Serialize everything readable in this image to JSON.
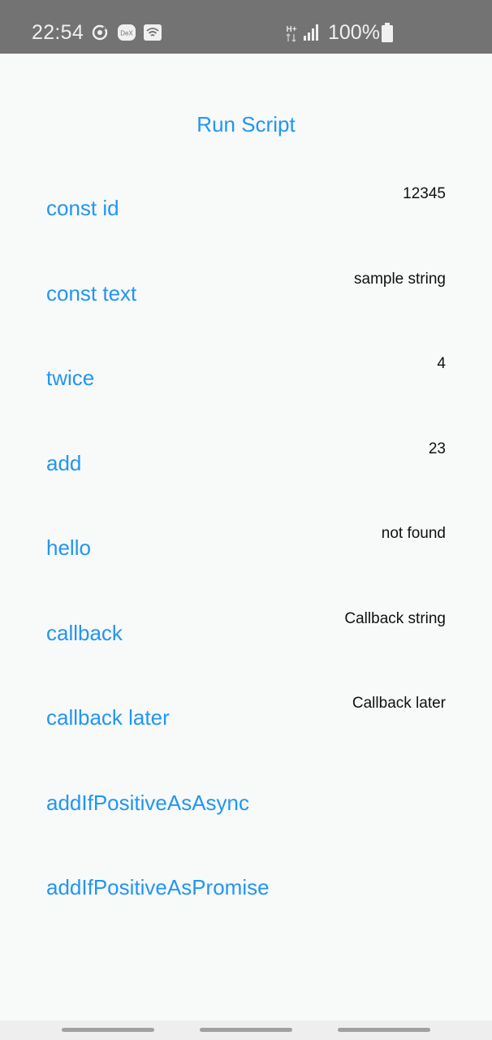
{
  "status_bar": {
    "time": "22:54",
    "icons": [
      "sync-icon",
      "dex-icon",
      "wifi-icon",
      "data-arrows-icon",
      "signal-icon",
      "battery-icon"
    ],
    "dex_label": "DeX",
    "network_label": "H+",
    "battery_text": "100%"
  },
  "app": {
    "run_script_label": "Run Script",
    "rows": [
      {
        "label": "const id",
        "value": "12345"
      },
      {
        "label": "const text",
        "value": "sample string"
      },
      {
        "label": "twice",
        "value": "4"
      },
      {
        "label": "add",
        "value": "23"
      },
      {
        "label": "hello",
        "value": "not found"
      },
      {
        "label": "callback",
        "value": "Callback string"
      },
      {
        "label": "callback later",
        "value": "Callback later"
      },
      {
        "label": "addIfPositiveAsAsync",
        "value": ""
      },
      {
        "label": "addIfPositiveAsPromise",
        "value": ""
      }
    ]
  },
  "colors": {
    "accent": "#2196f3",
    "status_bar_bg": "#737373",
    "background": "#f8f9f9",
    "value_text": "#111111"
  }
}
